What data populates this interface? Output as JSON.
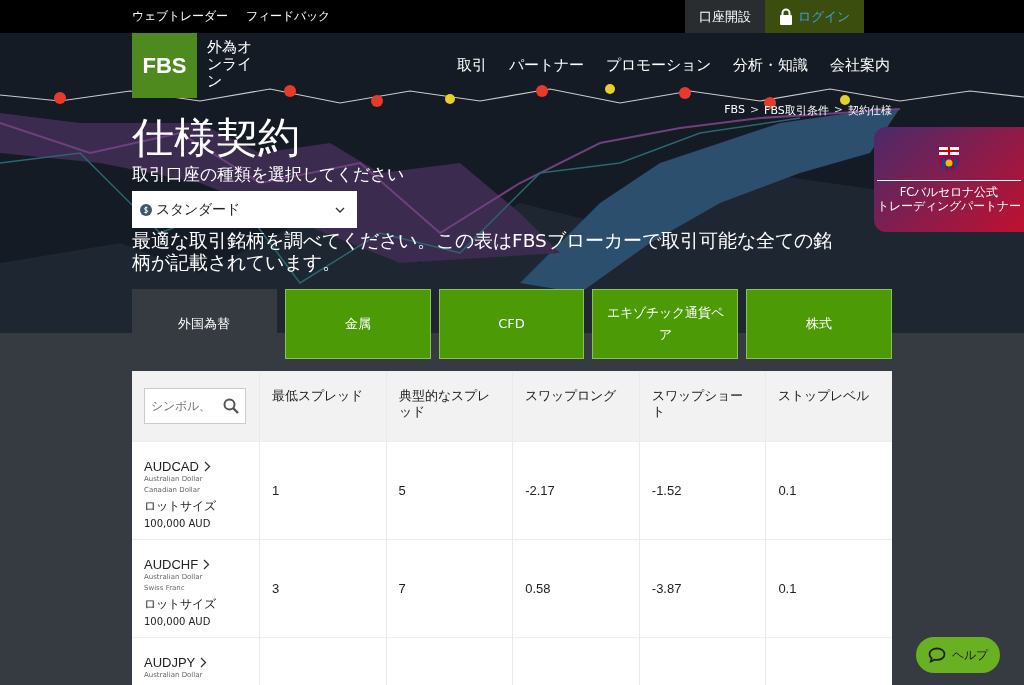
{
  "top_bar": {
    "links": [
      "ウェブトレーダー",
      "フィードバック"
    ],
    "open_account": "口座開設",
    "login": "ログイン"
  },
  "header": {
    "logo": "FBS",
    "tagline": "外為オンライン",
    "nav": [
      "取引",
      "パートナー",
      "プロモーション",
      "分析・知識",
      "会社案内"
    ]
  },
  "breadcrumb": [
    {
      "label": "FBS",
      "separator": ">"
    },
    {
      "label": "FBS取引条件",
      "separator": ">"
    },
    {
      "label": "契約仕様"
    }
  ],
  "title": "仕様契約",
  "account_prompt": "取引口座の種類を選択してください",
  "account_select": {
    "value": "スタンダード"
  },
  "description": "最適な取引銘柄を調べてください。この表はFBSブローカーで取引可能な全ての銘柄が記載されています。",
  "sponsor_badge": {
    "lines": [
      "FCバルセロナ公式",
      "トレーディングパートナー"
    ]
  },
  "tabs": [
    {
      "label": "外国為替",
      "selected": true
    },
    {
      "label": "金属",
      "selected": false
    },
    {
      "label": "CFD",
      "selected": false
    },
    {
      "label": "エキゾチック通貨ペア",
      "selected": false
    },
    {
      "label": "株式",
      "selected": false
    }
  ],
  "table": {
    "search": {
      "placeholder": "シンボル、"
    },
    "columns": [
      "最低スプレッド",
      "典型的なスプレッド",
      "スワップロング",
      "スワップショート",
      "ストップレベル"
    ],
    "rows": [
      {
        "symbol": "AUDCAD",
        "currencies": [
          "Australian Dollar",
          "Canadian Dollar"
        ],
        "lot_label": "ロットサイズ",
        "lot_size": "100,000 AUD",
        "values": [
          "1",
          "5",
          "-2.17",
          "-1.52",
          "0.1"
        ]
      },
      {
        "symbol": "AUDCHF",
        "currencies": [
          "Australian Dollar",
          "Swiss Franc"
        ],
        "lot_label": "ロットサイズ",
        "lot_size": "100,000 AUD",
        "values": [
          "3",
          "7",
          "0.58",
          "-3.87",
          "0.1"
        ]
      },
      {
        "symbol": "AUDJPY",
        "currencies": [
          "Australian Dollar"
        ]
      }
    ]
  },
  "help_button": "ヘルプ"
}
